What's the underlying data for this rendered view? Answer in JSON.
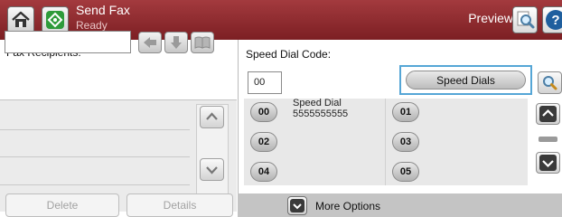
{
  "header": {
    "title": "Send Fax",
    "status": "Ready",
    "preview_label": "Preview",
    "home_icon": "home-icon",
    "app_icon": "fax-app-icon",
    "preview_icon": "magnifier-icon",
    "help_icon": "help-icon"
  },
  "left_panel": {
    "recipients_label": "Fax Recipients:",
    "recipients_value": "",
    "delete_label": "Delete",
    "details_label": "Details"
  },
  "right_panel": {
    "speed_dial_code_label": "Speed Dial Code:",
    "speed_dial_code_value": "00",
    "speed_dials_button": "Speed Dials",
    "more_options": "More Options",
    "entries": [
      {
        "code": "00",
        "name": "Speed Dial",
        "number": "5555555555"
      },
      {
        "code": "01",
        "name": "",
        "number": ""
      },
      {
        "code": "02",
        "name": "",
        "number": ""
      },
      {
        "code": "03",
        "name": "",
        "number": ""
      },
      {
        "code": "04",
        "name": "",
        "number": ""
      },
      {
        "code": "05",
        "name": "",
        "number": ""
      }
    ]
  },
  "colors": {
    "header_top": "#a33a3e",
    "header_bottom": "#7c1f23",
    "focus_border": "#55a6d6",
    "panel_gray": "#e8e8e8",
    "disabled_text": "#a2a2a2"
  }
}
